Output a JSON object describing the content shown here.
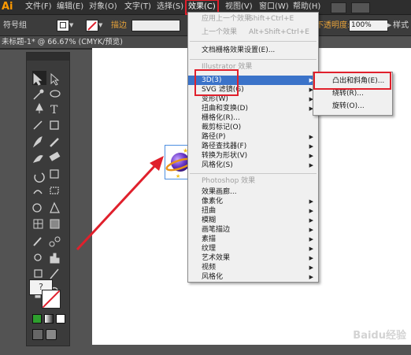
{
  "app": {
    "logo": "Ai"
  },
  "menubar": {
    "items": [
      {
        "label": "文件(F)"
      },
      {
        "label": "编辑(E)"
      },
      {
        "label": "对象(O)"
      },
      {
        "label": "文字(T)"
      },
      {
        "label": "选择(S)"
      },
      {
        "label": "效果(C)"
      },
      {
        "label": "视图(V)"
      },
      {
        "label": "窗口(W)"
      },
      {
        "label": "帮助(H)"
      }
    ]
  },
  "controlbar": {
    "group_label": "符号组",
    "stroke_label": "描边",
    "opacity_label": "不透明度:",
    "opacity_value": "100%",
    "style_label": "样式"
  },
  "document": {
    "tab_title": "未标题-1* @ 66.67% (CMYK/预览)"
  },
  "effect_menu": {
    "items": [
      {
        "label": "应用上一个效果",
        "shortcut": "Shift+Ctrl+E",
        "disabled": true
      },
      {
        "label": "上一个效果",
        "shortcut": "Alt+Shift+Ctrl+E",
        "disabled": true
      },
      {
        "label": "文档栅格效果设置(E)..."
      },
      {
        "section": "Illustrator 效果"
      },
      {
        "label": "3D(3)",
        "submenu": true,
        "highlighted": true
      },
      {
        "label": "SVG 滤镜(G)",
        "submenu": true
      },
      {
        "label": "变形(W)",
        "submenu": true
      },
      {
        "label": "扭曲和变换(D)",
        "submenu": true
      },
      {
        "label": "栅格化(R)..."
      },
      {
        "label": "裁剪标记(O)"
      },
      {
        "label": "路径(P)",
        "submenu": true
      },
      {
        "label": "路径查找器(F)",
        "submenu": true
      },
      {
        "label": "转换为形状(V)",
        "submenu": true
      },
      {
        "label": "风格化(S)",
        "submenu": true
      },
      {
        "section": "Photoshop 效果"
      },
      {
        "label": "效果画廊..."
      },
      {
        "label": "像素化",
        "submenu": true
      },
      {
        "label": "扭曲",
        "submenu": true
      },
      {
        "label": "模糊",
        "submenu": true
      },
      {
        "label": "画笔描边",
        "submenu": true
      },
      {
        "label": "素描",
        "submenu": true
      },
      {
        "label": "纹理",
        "submenu": true
      },
      {
        "label": "艺术效果",
        "submenu": true
      },
      {
        "label": "视频",
        "submenu": true
      },
      {
        "label": "风格化",
        "submenu": true
      }
    ]
  },
  "submenu_3d": {
    "items": [
      {
        "label": "凸出和斜角(E)..."
      },
      {
        "label": "绕转(R)..."
      },
      {
        "label": "旋转(O)..."
      }
    ]
  },
  "colors": {
    "highlight": "#3b73c9",
    "annotation_red": "#e0202c",
    "logo": "#ff9a00"
  },
  "watermark": {
    "text": "Baidu经验"
  }
}
